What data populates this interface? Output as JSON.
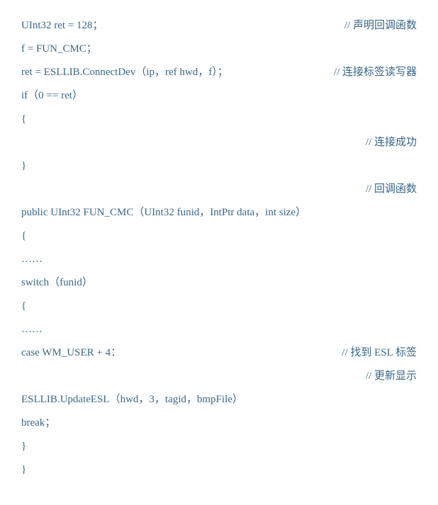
{
  "lines": [
    {
      "code": "UInt32 ret = 128；",
      "comment": "// 声明回调函数"
    },
    {
      "code": "f = FUN_CMC；",
      "comment": ""
    },
    {
      "code": "ret = ESLLIB.ConnectDev（ip，ref hwd，f）；",
      "comment": "// 连接标签读写器"
    },
    {
      "code": "if（0 == ret）",
      "comment": ""
    },
    {
      "code": "{",
      "comment": ""
    },
    {
      "code": "",
      "comment": "// 连接成功"
    },
    {
      "code": "}",
      "comment": ""
    },
    {
      "code": "",
      "comment": "// 回调函数"
    },
    {
      "code": "public UInt32 FUN_CMC（UInt32 funid，IntPtr data，int size）",
      "comment": ""
    },
    {
      "code": "{",
      "comment": ""
    },
    {
      "code": "……",
      "comment": ""
    },
    {
      "code": "switch（funid）",
      "comment": ""
    },
    {
      "code": "{",
      "comment": ""
    },
    {
      "code": "……",
      "comment": ""
    },
    {
      "code": "case WM_USER + 4：",
      "comment": "// 找到 ESL 标签"
    },
    {
      "code": "",
      "comment": "// 更新显示"
    },
    {
      "code": "ESLLIB.UpdateESL（hwd，3，tagid，bmpFile）",
      "comment": ""
    },
    {
      "code": "break；",
      "comment": ""
    },
    {
      "code": "}",
      "comment": ""
    },
    {
      "code": "}",
      "comment": ""
    }
  ]
}
